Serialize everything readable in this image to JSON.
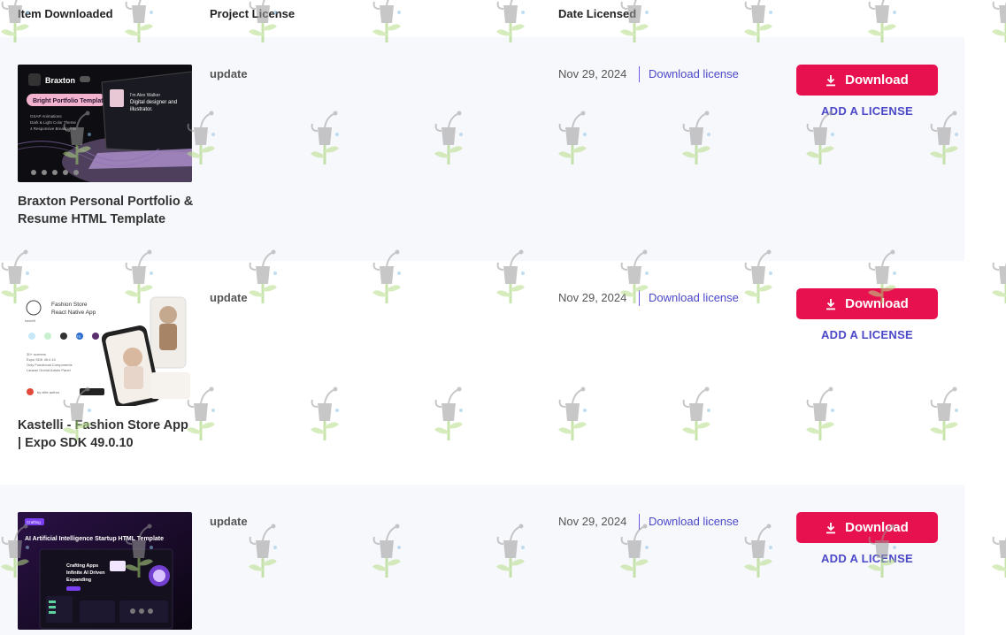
{
  "header": {
    "item_downloaded": "Item Downloaded",
    "project_license": "Project License",
    "date_licensed": "Date Licensed"
  },
  "rows": [
    {
      "title": "Braxton Personal Portfolio & Resume HTML Template",
      "license": "update",
      "date": "Nov 29, 2024",
      "download_license": "Download license",
      "download_button": "Download",
      "add_license": "ADD A LICENSE",
      "thumb": {
        "brand": "Braxton",
        "tag": "Bright Portfolio Template",
        "bullets": [
          "GSAP Animations",
          "Dark & Light Color Theme",
          "4 Responsive Breakpoints"
        ],
        "headline_1": "I'm Alex Walker",
        "headline_2": "Digital designer and",
        "headline_3": "illustrator."
      }
    },
    {
      "title": "Kastelli - Fashion Store App | Expo SDK 49.0.10",
      "license": "update",
      "date": "Nov 29, 2024",
      "download_license": "Download license",
      "download_button": "Download",
      "add_license": "ADD A LICENSE",
      "thumb": {
        "line_1": "Fashion Store",
        "line_2": "React Native App",
        "brand": "kastelli",
        "badge": "TS",
        "bullets": [
          "30+ screens",
          "Expo SDK 49.0.10",
          "Only Functional Components",
          "Laravel Orchid Admin Panel"
        ],
        "author": "by elite author"
      }
    },
    {
      "title": "",
      "license": "update",
      "date": "Nov 29, 2024",
      "download_license": "Download license",
      "download_button": "Download",
      "add_license": "ADD A LICENSE",
      "thumb": {
        "tag": "Crafting",
        "headline": "AI Artificial Intelligence Startup HTML Template",
        "hero_1": "Crafting Apps",
        "hero_2": "Infinite AI Driven",
        "hero_3": "Expanding"
      }
    }
  ],
  "colors": {
    "accent": "#e8114f",
    "link": "#4b48c8",
    "row_alt_bg": "#f7f8fb"
  },
  "icons": {
    "download_button_icon": "download-icon",
    "watermark": "watering-can-sprout-icon"
  }
}
